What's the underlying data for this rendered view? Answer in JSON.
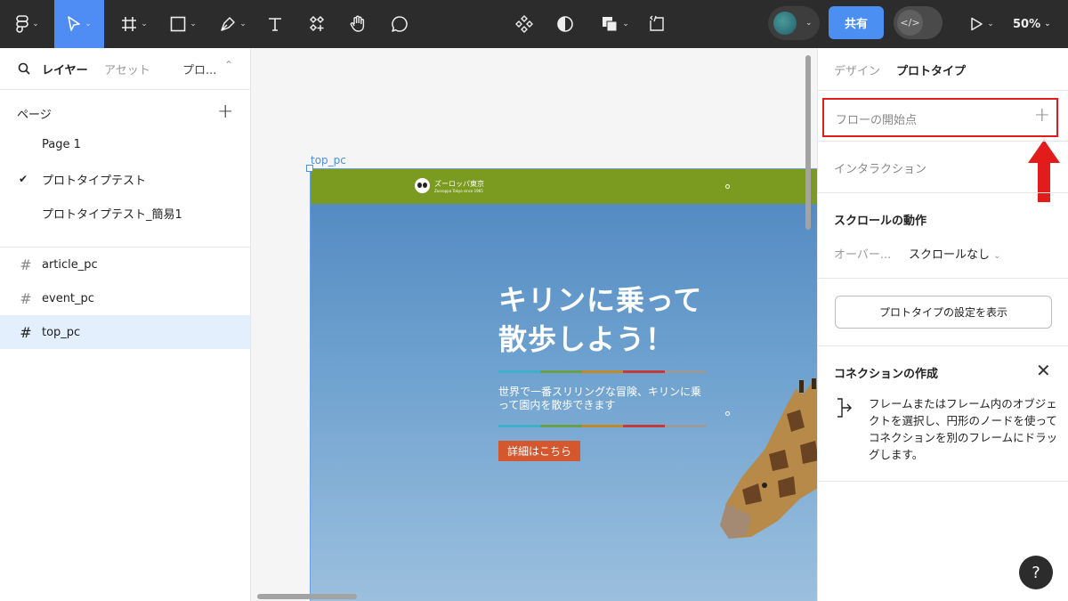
{
  "toolbar": {
    "share_label": "共有",
    "zoom_label": "50%"
  },
  "left_panel": {
    "tabs": {
      "layers": "レイヤー",
      "assets": "アセット",
      "prototype": "プロ..."
    },
    "pages_title": "ページ",
    "pages": [
      "Page 1",
      "プロトタイプテスト",
      "プロトタイプテスト_簡易1"
    ],
    "layers": [
      "article_pc",
      "event_pc",
      "top_pc"
    ]
  },
  "canvas": {
    "frame_label": "top_pc",
    "site": {
      "logo_text": "ズーロッパ東京",
      "logo_sub": "Zooroppa Tokyo since 1965",
      "hero_title": "キリンに乗って散歩しよう！",
      "hero_desc": "世界で一番スリリングな冒険、キリンに乗って園内を散歩できます",
      "cta_label": "詳細はこちら"
    }
  },
  "right_panel": {
    "tabs": {
      "design": "デザイン",
      "prototype": "プロトタイプ"
    },
    "flow_start": "フローの開始点",
    "interaction": "インタラクション",
    "scroll_title": "スクロールの動作",
    "overflow_label": "オーバー...",
    "overflow_value": "スクロールなし",
    "settings_button": "プロトタイプの設定を表示",
    "connection_title": "コネクションの作成",
    "connection_desc": "フレームまたはフレーム内のオブジェクトを選択し、円形のノードを使ってコネクションを別のフレームにドラッグします。",
    "help": "?"
  },
  "colors": {
    "accent": "#4b8ff2",
    "highlight_red": "#e21b1b",
    "site_header": "#7a9a20",
    "cta": "#d4572d"
  }
}
